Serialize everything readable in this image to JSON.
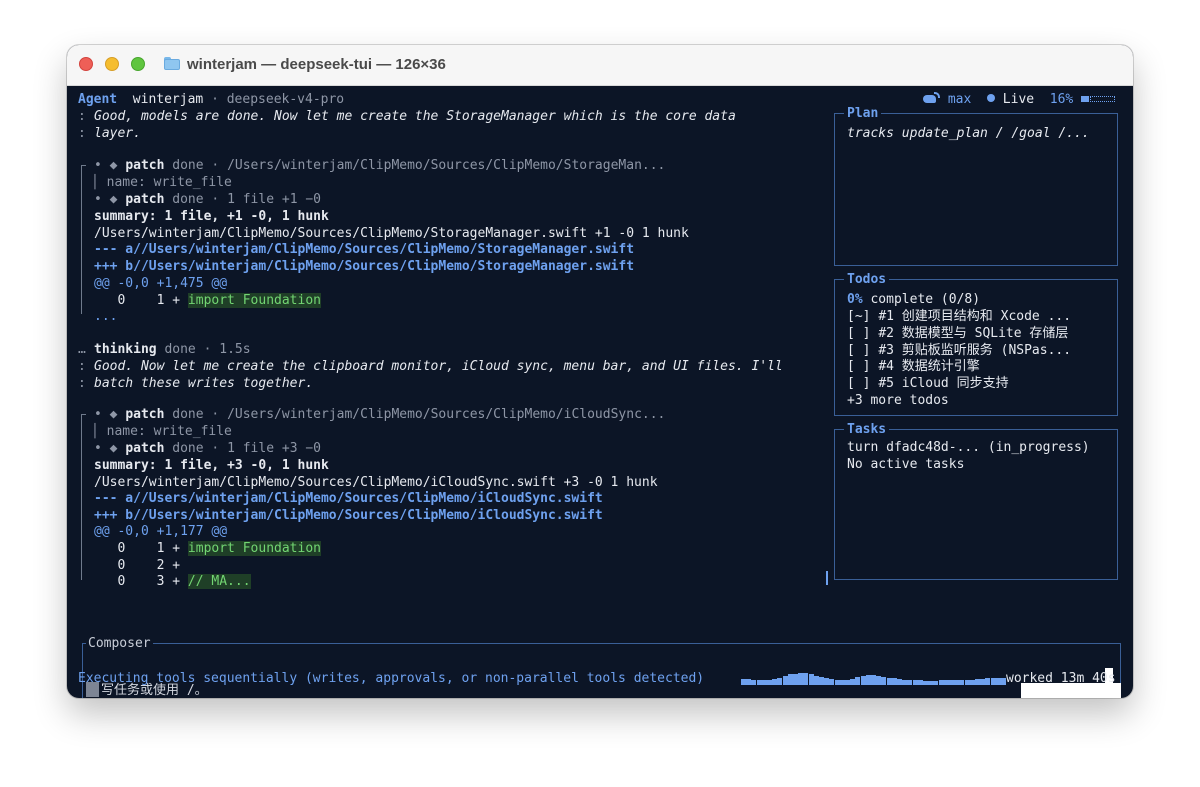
{
  "window": {
    "title": "winterjam — deepseek-tui — 126×36"
  },
  "header": {
    "agent_label": "Agent",
    "workspace": "winterjam",
    "separator": "·",
    "model": "deepseek-v4-pro",
    "mode": "max",
    "status": "Live",
    "context_pct": "16%",
    "context_fraction": 0.16
  },
  "transcript": {
    "msg1_line1": "Good, models are done. Now let me create the StorageManager which is the core data",
    "msg1_line2": "layer.",
    "patch1": {
      "tool": "patch",
      "state": "done",
      "sep": "·",
      "path": "/Users/winterjam/ClipMemo/Sources/ClipMemo/StorageMan...",
      "name_line": "name: write_file",
      "stat": "1 file +1 −0",
      "summary": "summary: 1 file, +1 -0, 1 hunk",
      "file_line": "/Users/winterjam/ClipMemo/Sources/ClipMemo/StorageManager.swift +1 -0 1 hunk",
      "minus_line": "--- a//Users/winterjam/ClipMemo/Sources/ClipMemo/StorageManager.swift",
      "plus_line": "+++ b//Users/winterjam/ClipMemo/Sources/ClipMemo/StorageManager.swift",
      "hunk": "@@ -0,0 +1,475 @@",
      "diff_line_prefix": "   0    1 + ",
      "diff_line_code": "import Foundation",
      "ellipsis": "..."
    },
    "thinking": {
      "label": "thinking",
      "state": "done",
      "sep": "·",
      "duration": "1.5s"
    },
    "msg2_line1": "Good. Now let me create the clipboard monitor, iCloud sync, menu bar, and UI files. I'll",
    "msg2_line2": "batch these writes together.",
    "patch2": {
      "tool": "patch",
      "state": "done",
      "sep": "·",
      "path": "/Users/winterjam/ClipMemo/Sources/ClipMemo/iCloudSync...",
      "name_line": "name: write_file",
      "stat": "1 file +3 −0",
      "summary": "summary: 1 file, +3 -0, 1 hunk",
      "file_line": "/Users/winterjam/ClipMemo/Sources/ClipMemo/iCloudSync.swift +3 -0 1 hunk",
      "minus_line": "--- a//Users/winterjam/ClipMemo/Sources/ClipMemo/iCloudSync.swift",
      "plus_line": "+++ b//Users/winterjam/ClipMemo/Sources/ClipMemo/iCloudSync.swift",
      "hunk": "@@ -0,0 +1,177 @@",
      "line1_prefix": "   0    1 + ",
      "line1_code": "import Foundation",
      "line2_prefix": "   0    2 +",
      "line3_prefix": "   0    3 + ",
      "line3_code": "// MA..."
    }
  },
  "plan": {
    "title": "Plan",
    "text": "tracks update_plan / /goal /..."
  },
  "todos": {
    "title": "Todos",
    "pct": "0%",
    "complete_text": " complete (0/8)",
    "items": [
      {
        "mark": "[~]",
        "text": "#1 创建项目结构和 Xcode ..."
      },
      {
        "mark": "[ ]",
        "text": "#2 数据模型与 SQLite 存储层"
      },
      {
        "mark": "[ ]",
        "text": "#3 剪贴板监听服务 (NSPas..."
      },
      {
        "mark": "[ ]",
        "text": "#4 数据统计引擎"
      },
      {
        "mark": "[ ]",
        "text": "#5 iCloud 同步支持"
      }
    ],
    "more": "+3 more todos"
  },
  "tasks": {
    "title": "Tasks",
    "turn": "turn dfadc48d-... (in_progress)",
    "empty": "No active tasks"
  },
  "composer": {
    "title": "Composer",
    "placeholder": "写任务或使用 /。"
  },
  "statusbar": {
    "message": "Executing tools sequentially (writes, approvals, or non-parallel tools detected)",
    "worked": "worked 13m 40s"
  },
  "colors": {
    "background": "#0c1526",
    "accent": "#6ea1ef",
    "highlight": "#f0a04b",
    "diff_add": "#72d572"
  }
}
